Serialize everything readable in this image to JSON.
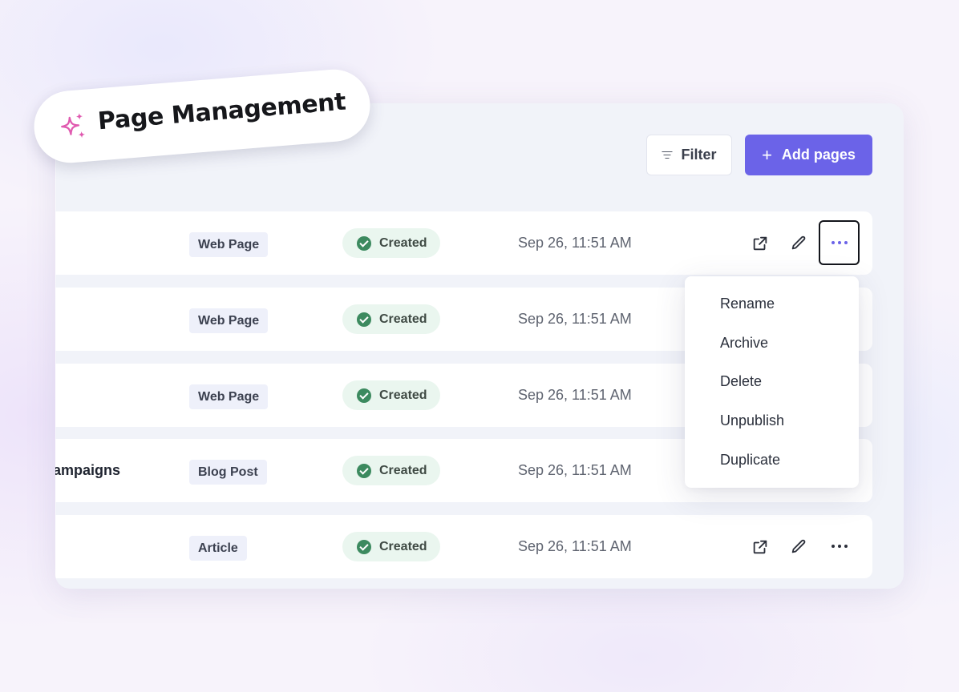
{
  "badge": {
    "title": "Page Management",
    "icon": "sparkles-icon"
  },
  "toolbar": {
    "filter_label": "Filter",
    "add_label": "Add pages",
    "add_icon": "+"
  },
  "rows": [
    {
      "title": "",
      "type": "Web Page",
      "status": "Created",
      "date": "Sep 26, 11:51 AM"
    },
    {
      "title": "",
      "type": "Web Page",
      "status": "Created",
      "date": "Sep 26, 11:51 AM"
    },
    {
      "title": "",
      "type": "Web Page",
      "status": "Created",
      "date": "Sep 26, 11:51 AM"
    },
    {
      "title": "ampaigns",
      "type": "Blog Post",
      "status": "Created",
      "date": "Sep 26, 11:51 AM"
    },
    {
      "title": "",
      "type": "Article",
      "status": "Created",
      "date": "Sep 26, 11:51 AM"
    }
  ],
  "menu": {
    "items": [
      "Rename",
      "Archive",
      "Delete",
      "Unpublish",
      "Duplicate"
    ]
  },
  "colors": {
    "accent": "#6b63e8",
    "status_bg": "#eaf6ef",
    "status_icon": "#3c8a5f",
    "sparkle": "#e05bb0"
  }
}
